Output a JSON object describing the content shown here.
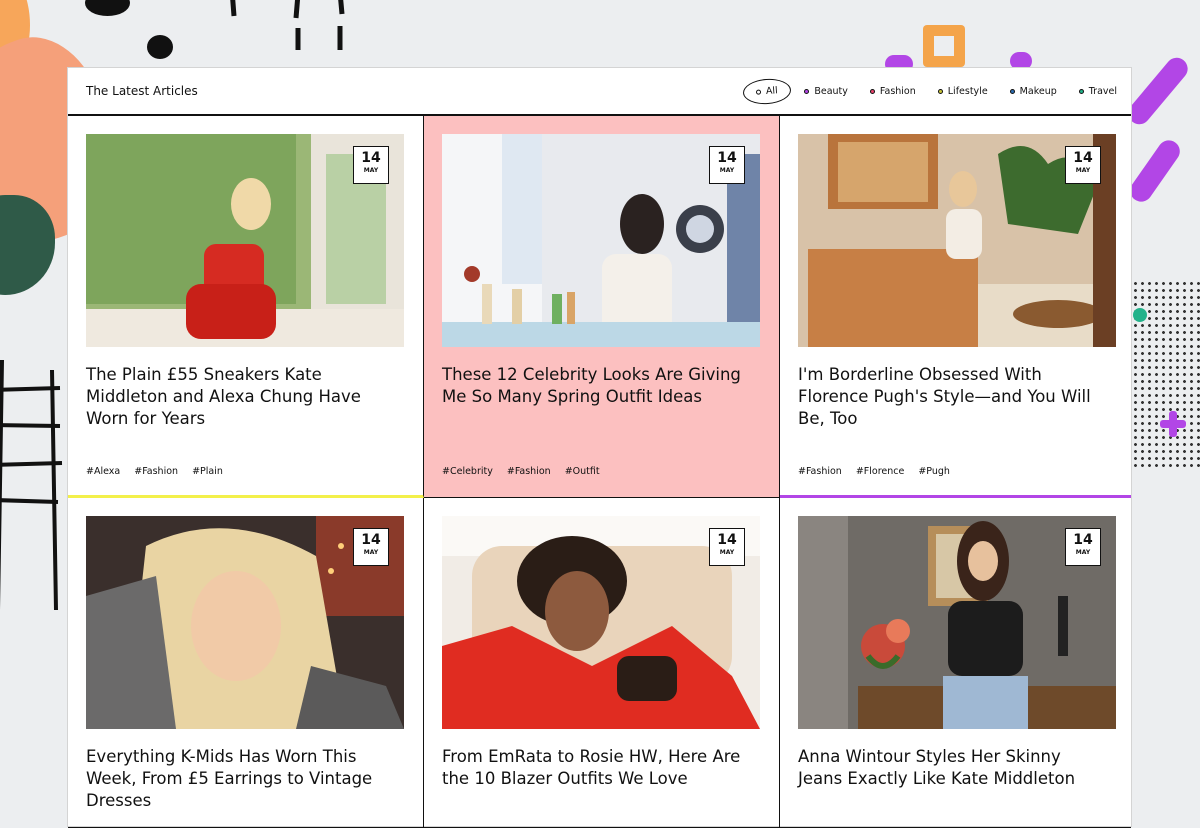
{
  "header": {
    "title": "The Latest Articles",
    "filters": [
      {
        "label": "All",
        "dot_color": "#111111",
        "active": true
      },
      {
        "label": "Beauty",
        "dot_color": "#b246e6"
      },
      {
        "label": "Fashion",
        "dot_color": "#e8426b"
      },
      {
        "label": "Lifestyle",
        "dot_color": "#c8c438"
      },
      {
        "label": "Makeup",
        "dot_color": "#2b6cb0"
      },
      {
        "label": "Travel",
        "dot_color": "#22b28a"
      }
    ]
  },
  "colors": {
    "highlight_card": "#fcc0c0",
    "accent_yellow": "#f3f04a",
    "accent_purple": "#b246e6"
  },
  "articles": [
    {
      "day": "14",
      "month": "MAY",
      "title": "The Plain £55 Sneakers Kate Middleton and Alexa Chung Have Worn for Years",
      "tags": [
        "#Alexa",
        "#Fashion",
        "#Plain"
      ]
    },
    {
      "day": "14",
      "month": "MAY",
      "title": "These 12 Celebrity Looks Are Giving Me So Many Spring Outfit Ideas",
      "tags": [
        "#Celebrity",
        "#Fashion",
        "#Outfit"
      ]
    },
    {
      "day": "14",
      "month": "MAY",
      "title": "I'm Borderline Obsessed With Florence Pugh's Style—and You Will Be, Too",
      "tags": [
        "#Fashion",
        "#Florence",
        "#Pugh"
      ]
    },
    {
      "day": "14",
      "month": "MAY",
      "title": "Everything K-Mids Has Worn This Week, From £5 Earrings to Vintage Dresses"
    },
    {
      "day": "14",
      "month": "MAY",
      "title": "From EmRata to Rosie HW, Here Are the 10 Blazer Outfits We Love"
    },
    {
      "day": "14",
      "month": "MAY",
      "title": "Anna Wintour Styles Her Skinny Jeans Exactly Like Kate Middleton"
    }
  ]
}
